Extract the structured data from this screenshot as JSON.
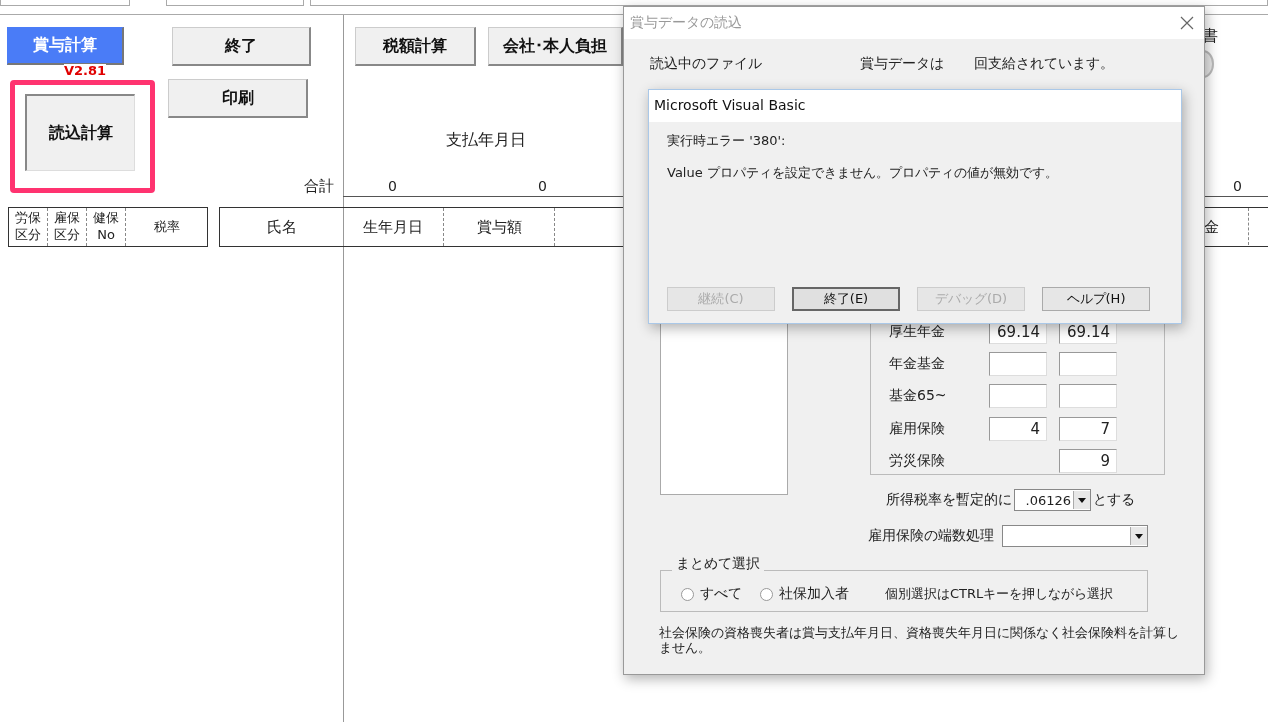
{
  "sheet": {
    "buttons": [
      {
        "kind": "primary",
        "label": "賞与計算"
      },
      {
        "kind": "plain",
        "label": "終了"
      },
      {
        "kind": "plain",
        "label": "印刷"
      },
      {
        "kind": "plain",
        "label": "税額計算"
      },
      {
        "kind": "plain",
        "label": "会社･本人負担"
      },
      {
        "kind": "big",
        "label": "読込計算"
      }
    ],
    "version": "V2.81",
    "pay_date_label": "支払年月日",
    "total_label": "合計",
    "totals": [
      "0",
      "0",
      "0"
    ],
    "right_label": "書",
    "left_headers": [
      [
        "労保",
        "区分"
      ],
      [
        "雇保",
        "区分"
      ],
      [
        "健保",
        "No"
      ],
      [
        "税率"
      ]
    ],
    "name_header": "氏名",
    "columns": [
      "生年月日",
      "賞与額"
    ],
    "right_header": "金"
  },
  "dialog": {
    "title": "賞与データの読込",
    "file_label": "読込中のファイル",
    "count_label": "賞与データは",
    "count_suffix": "回支給されています。",
    "rates": [
      {
        "label": "厚生年金",
        "kind": "both",
        "company": "69.14",
        "employee": "69.14"
      },
      {
        "label": "年金基金",
        "kind": "both"
      },
      {
        "label": "基金65~",
        "kind": "both"
      },
      {
        "label": "雇用保険",
        "kind": "both",
        "company": "4",
        "employee": "7"
      },
      {
        "label": "労災保険",
        "kind": "employee_only",
        "employee": "9"
      }
    ],
    "tax_rate_label": "所得税率を暫定的に",
    "tax_rate_value": ".06126",
    "tax_rate_suffix": "とする",
    "rounding_label": "雇用保険の端数処理",
    "group_title": "まとめて選択",
    "radios": [
      {
        "label": "すべて",
        "selected": false
      },
      {
        "label": "社保加入者",
        "selected": false
      }
    ],
    "group_hint": "個別選択はCTRLキーを押しながら選択",
    "note": "社会保険の資格喪失者は賞与支払年月日、資格喪失年月日に関係なく社会保険料を計算しません。"
  },
  "error_dialog": {
    "title": "Microsoft Visual Basic",
    "error": "実行時エラー '380':",
    "message": "Value プロパティを設定できません。プロパティの値が無効です。",
    "buttons": [
      {
        "label": "継続(C)",
        "disabled": true,
        "default": false
      },
      {
        "label": "終了(E)",
        "disabled": false,
        "default": true
      },
      {
        "label": "デバッグ(D)",
        "disabled": true,
        "default": false
      },
      {
        "label": "ヘルプ(H)",
        "disabled": false,
        "default": false
      }
    ]
  }
}
